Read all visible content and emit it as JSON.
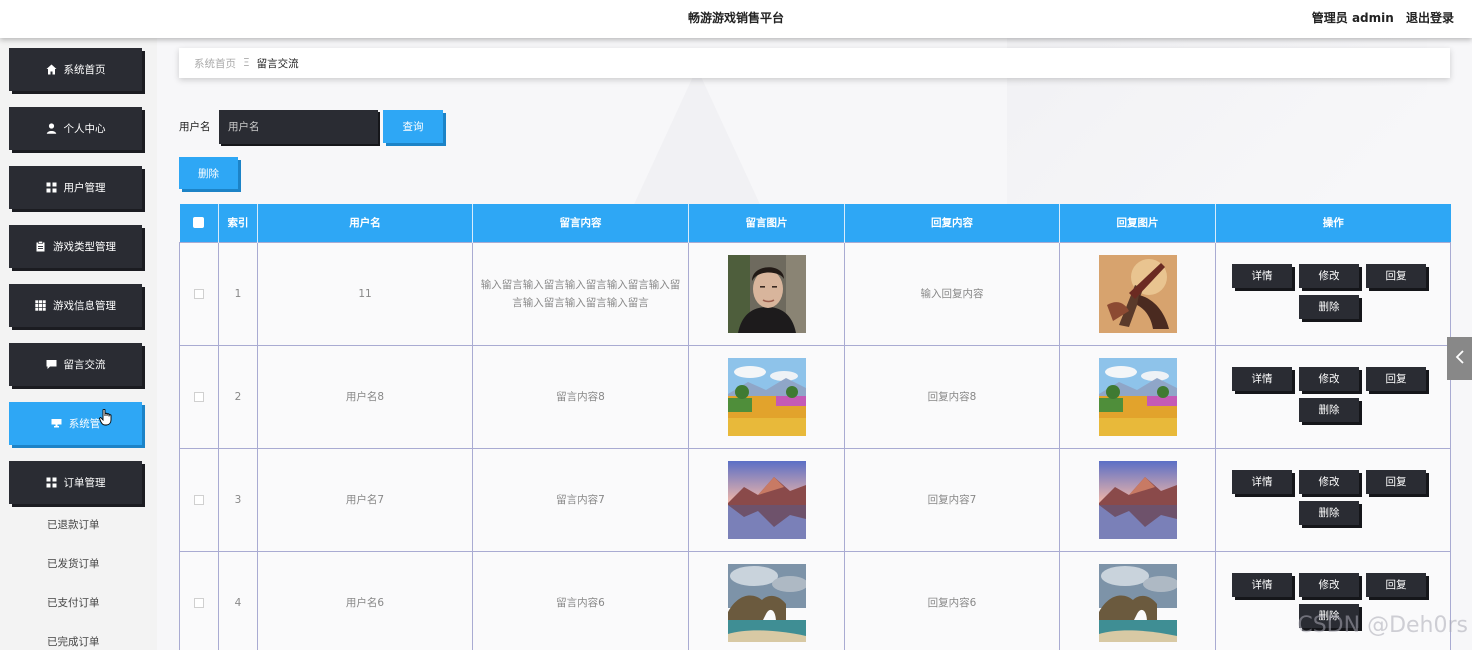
{
  "header": {
    "title": "畅游游戏销售平台",
    "user": "管理员 admin",
    "logout": "退出登录"
  },
  "sidebar": {
    "items": [
      {
        "label": "系统首页",
        "icon": "home-icon"
      },
      {
        "label": "个人中心",
        "icon": "person-icon"
      },
      {
        "label": "用户管理",
        "icon": "grid-icon"
      },
      {
        "label": "游戏类型管理",
        "icon": "clipboard-icon"
      },
      {
        "label": "游戏信息管理",
        "icon": "grid-small-icon"
      },
      {
        "label": "留言交流",
        "icon": "chat-icon"
      },
      {
        "label": "系统管",
        "icon": "system-icon",
        "active": true
      },
      {
        "label": "订单管理",
        "icon": "grid-icon"
      }
    ],
    "subitems": [
      "已退款订单",
      "已发货订单",
      "已支付订单",
      "已完成订单"
    ]
  },
  "breadcrumb": {
    "home": "系统首页",
    "separator": "Ξ",
    "current": "留言交流"
  },
  "search": {
    "label": "用户名",
    "placeholder": "用户名",
    "button": "查询"
  },
  "toolbar": {
    "delete": "删除"
  },
  "table": {
    "headers": [
      "索引",
      "用户名",
      "留言内容",
      "留言图片",
      "回复内容",
      "回复图片",
      "操作"
    ],
    "rows": [
      {
        "index": "1",
        "username": "11",
        "message": "输入留言输入留言输入留言输入留言输入留言输入留言输入留言输入留言",
        "reply": "输入回复内容",
        "message_image": "portrait",
        "reply_image": "fantasy-art"
      },
      {
        "index": "2",
        "username": "用户名8",
        "message": "留言内容8",
        "reply": "回复内容8",
        "message_image": "flower-field",
        "reply_image": "flower-field"
      },
      {
        "index": "3",
        "username": "用户名7",
        "message": "留言内容7",
        "reply": "回复内容7",
        "message_image": "mountain-lake",
        "reply_image": "mountain-lake"
      },
      {
        "index": "4",
        "username": "用户名6",
        "message": "留言内容6",
        "reply": "回复内容6",
        "message_image": "rock-arch-coast",
        "reply_image": "rock-arch-coast"
      }
    ],
    "actions": {
      "detail": "详情",
      "edit": "修改",
      "reply": "回复",
      "delete": "删除"
    }
  },
  "watermark": "CSDN @Deh0rs",
  "colors": {
    "accent": "#2ea7f5",
    "dark": "#2a2c33",
    "border": "#a9abd2"
  }
}
